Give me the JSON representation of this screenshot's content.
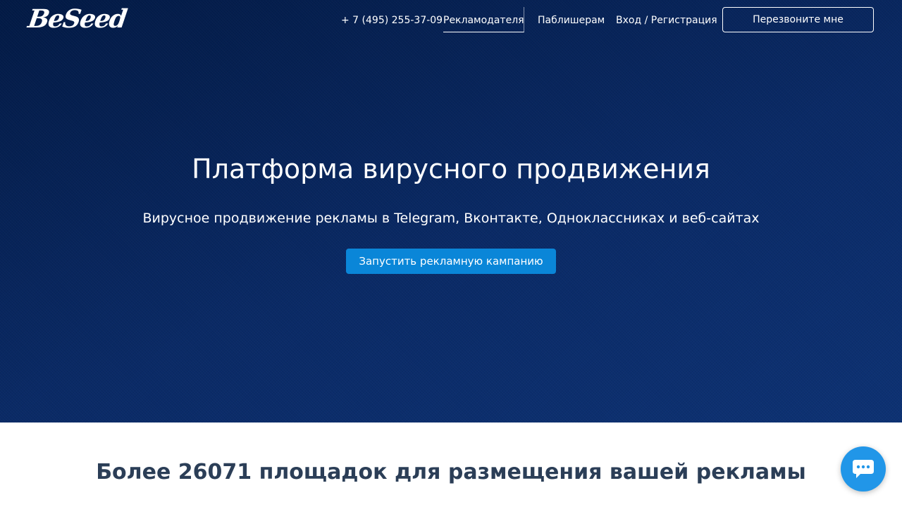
{
  "logo": {
    "text": "BeSeed"
  },
  "nav": {
    "phone": "+ 7 (495) 255-37-09",
    "advertisers": "Рекламодателям",
    "publishers": "Паблишерам",
    "login": "Вход / Регистрация",
    "callback_button": "Перезвоните мне"
  },
  "hero": {
    "title": "Платформа вирусного продвижения",
    "subtitle": "Вирусное продвижение рекламы в Telegram, Вконтакте, Одноклассниках и веб-сайтах",
    "cta_button": "Запустить рекламную кампанию"
  },
  "stats": {
    "title": "Более 26071 площадок для размещения вашей рекламы"
  },
  "chat": {
    "icon": "chat-bubble-icon"
  },
  "colors": {
    "hero_bg": "#0a2a66",
    "cta": "#0a86d8",
    "chat": "#2196e8",
    "heading": "#2b3e57"
  }
}
